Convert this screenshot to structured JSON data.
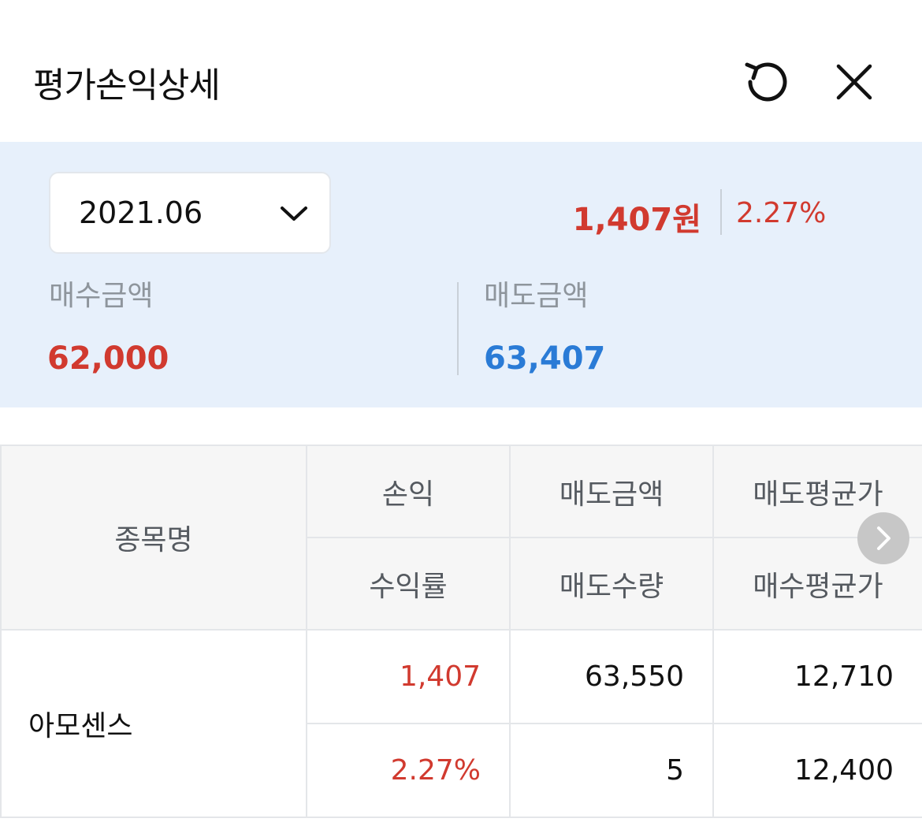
{
  "header": {
    "title": "평가손익상세",
    "refresh_icon": "refresh-icon",
    "close_icon": "close-icon"
  },
  "summary": {
    "selected_month": "2021.06",
    "profit_loss": "1,407원",
    "profit_rate": "2.27%",
    "buy_label": "매수금액",
    "buy_amount": "62,000",
    "sell_label": "매도금액",
    "sell_amount": "63,407"
  },
  "table": {
    "headers": {
      "name": "종목명",
      "profit": "손익",
      "sell_amount": "매도금액",
      "sell_avg_price": "매도평균가",
      "return_rate": "수익률",
      "sell_qty": "매도수량",
      "buy_avg_price": "매수평균가"
    },
    "rows": [
      {
        "name": "아모센스",
        "profit": "1,407",
        "sell_amount": "63,550",
        "sell_avg_price": "12,710",
        "return_rate": "2.27%",
        "sell_qty": "5",
        "buy_avg_price": "12,400"
      }
    ]
  },
  "colors": {
    "positive": "#d13a2f",
    "sell_blue": "#2a7bd6",
    "panel_bg": "#e7f0fb"
  }
}
